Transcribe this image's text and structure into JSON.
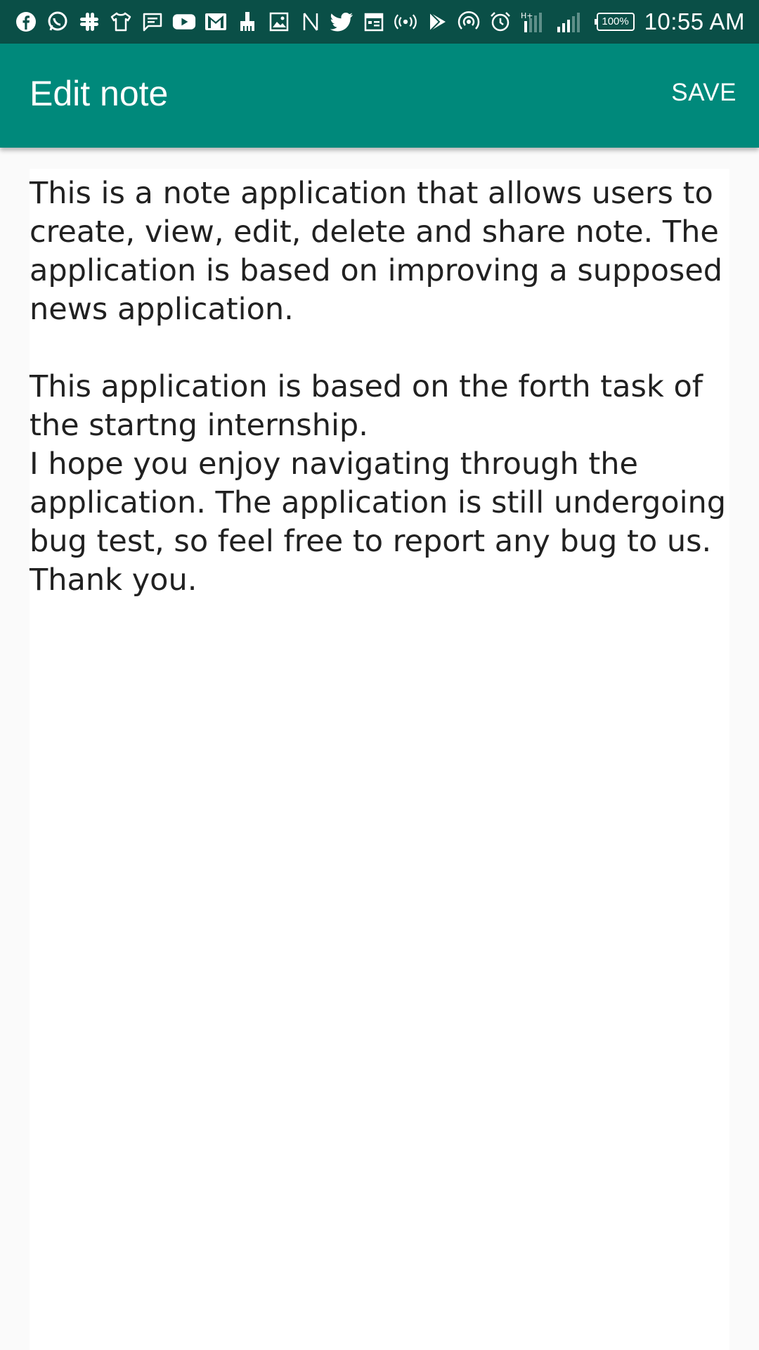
{
  "status_bar": {
    "icons": [
      "facebook-icon",
      "whatsapp-icon",
      "slack-icon",
      "shirt-icon",
      "message-icon",
      "youtube-icon",
      "gmail-icon",
      "broom-icon",
      "image-icon",
      "notion-icon",
      "twitter-icon",
      "calendar-icon",
      "broadcast-icon",
      "play-store-icon",
      "hotspot-icon",
      "alarm-icon",
      "data-signal-icon",
      "cell-signal-icon"
    ],
    "battery_label": "100%",
    "time": "10:55 AM"
  },
  "app_bar": {
    "title": "Edit note",
    "save_label": "SAVE",
    "color": "#00897b",
    "status_color": "#0a4f47"
  },
  "note": {
    "body": "This is a note application that allows users to create, view, edit, delete and share note. The application is based on improving a supposed news application.\n\nThis application is based on the forth task of the startng internship.\nI hope you enjoy navigating through the application. The application is still undergoing bug test, so feel free to report any bug to us.\nThank you."
  }
}
